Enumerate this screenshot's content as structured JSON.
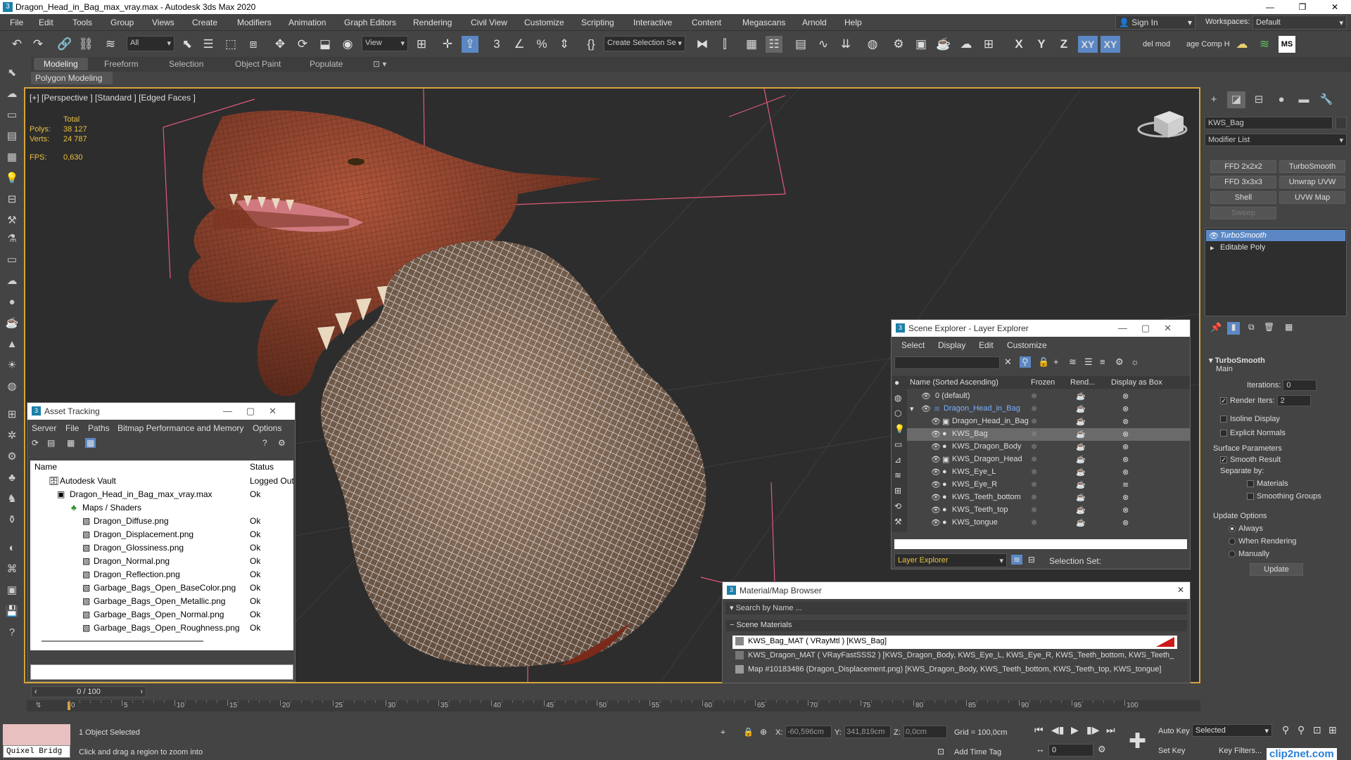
{
  "window": {
    "title": "Dragon_Head_in_Bag_max_vray.max - Autodesk 3ds Max 2020",
    "controls": [
      "—",
      "❐",
      "✕"
    ]
  },
  "menubar": {
    "items": [
      "File",
      "Edit",
      "Tools",
      "Group",
      "Views",
      "Create",
      "Modifiers",
      "Animation",
      "Graph Editors",
      "Rendering",
      "Civil View",
      "Customize",
      "Scripting",
      "Interactive",
      "Content",
      "Megascans",
      "Arnold",
      "Help"
    ],
    "sign_in": "Sign In",
    "workspaces_label": "Workspaces:",
    "workspace_value": "Default"
  },
  "toolbar": {
    "filter_value": "All",
    "ref_coord": "View",
    "create_selection_set": "Create Selection Se",
    "axis_x": "X",
    "axis_y": "Y",
    "axis_z": "Z",
    "axis_xy": "XY",
    "axis_xy2": "XY",
    "del_mod": "del mod",
    "comp_help": "age Comp Hel",
    "ms": "MS"
  },
  "ribbon": {
    "tabs": [
      "Modeling",
      "Freeform",
      "Selection",
      "Object Paint",
      "Populate"
    ],
    "active_panel": "Polygon Modeling"
  },
  "viewport": {
    "label": "[+] [Perspective ] [Standard ] [Edged Faces ]",
    "stats": {
      "total_label": "Total",
      "polys_label": "Polys:",
      "polys": "38 127",
      "verts_label": "Verts:",
      "verts": "24 787",
      "fps_label": "FPS:",
      "fps": "0,630"
    }
  },
  "command_panel": {
    "object_name": "KWS_Bag",
    "modifier_list": "Modifier List",
    "buttons": [
      "FFD 2x2x2",
      "TurboSmooth",
      "FFD 3x3x3",
      "Unwrap UVW",
      "Shell",
      "UVW Map",
      "Sweep"
    ],
    "stack": [
      "TurboSmooth",
      "Editable Poly"
    ],
    "turbosmooth": {
      "title": "TurboSmooth",
      "main": "Main",
      "iterations_label": "Iterations:",
      "iterations": "0",
      "render_iters_label": "Render Iters:",
      "render_iters": "2",
      "isoline": "Isoline Display",
      "explicit_normals": "Explicit Normals",
      "surface_params": "Surface Parameters",
      "smooth_result": "Smooth Result",
      "separate_by": "Separate by:",
      "materials": "Materials",
      "smoothing_groups": "Smoothing Groups",
      "update_options": "Update Options",
      "always": "Always",
      "when_rendering": "When Rendering",
      "manually": "Manually",
      "update_btn": "Update"
    }
  },
  "asset_tracking": {
    "title": "Asset Tracking",
    "menu": [
      "Server",
      "File",
      "Paths",
      "Bitmap Performance and Memory",
      "Options"
    ],
    "columns": [
      "Name",
      "Status"
    ],
    "rows": [
      {
        "name": "Autodesk Vault",
        "status": "Logged Out"
      },
      {
        "name": "Dragon_Head_in_Bag_max_vray.max",
        "status": "Ok"
      },
      {
        "name": "Maps / Shaders",
        "status": ""
      },
      {
        "name": "Dragon_Diffuse.png",
        "status": "Ok"
      },
      {
        "name": "Dragon_Displacement.png",
        "status": "Ok"
      },
      {
        "name": "Dragon_Glossiness.png",
        "status": "Ok"
      },
      {
        "name": "Dragon_Normal.png",
        "status": "Ok"
      },
      {
        "name": "Dragon_Reflection.png",
        "status": "Ok"
      },
      {
        "name": "Garbage_Bags_Open_BaseColor.png",
        "status": "Ok"
      },
      {
        "name": "Garbage_Bags_Open_Metallic.png",
        "status": "Ok"
      },
      {
        "name": "Garbage_Bags_Open_Normal.png",
        "status": "Ok"
      },
      {
        "name": "Garbage_Bags_Open_Roughness.png",
        "status": "Ok"
      }
    ]
  },
  "scene_explorer": {
    "title": "Scene Explorer - Layer Explorer",
    "menu": [
      "Select",
      "Display",
      "Edit",
      "Customize"
    ],
    "columns": [
      "Name (Sorted Ascending)",
      "Frozen",
      "Rend...",
      "Display as Box"
    ],
    "rows": [
      "0 (default)",
      "Dragon_Head_in_Bag",
      "Dragon_Head_in_Bag",
      "KWS_Bag",
      "KWS_Dragon_Body",
      "KWS_Dragon_Head",
      "KWS_Eye_L",
      "KWS_Eye_R",
      "KWS_Teeth_bottom",
      "KWS_Teeth_top",
      "KWS_tongue"
    ],
    "footer_dropdown": "Layer Explorer",
    "selection_set_label": "Selection Set:"
  },
  "material_browser": {
    "title": "Material/Map Browser",
    "search_placeholder": "Search by Name ...",
    "section": "Scene Materials",
    "rows": [
      "KWS_Bag_MAT  ( VRayMtl ) [KWS_Bag]",
      "KWS_Dragon_MAT  ( VRayFastSSS2 ) [KWS_Dragon_Body, KWS_Eye_L, KWS_Eye_R, KWS_Teeth_bottom, KWS_Teeth_",
      "Map #10183486 (Dragon_Displacement.png) [KWS_Dragon_Body, KWS_Teeth_bottom, KWS_Teeth_top, KWS_tongue]"
    ]
  },
  "timeline": {
    "frame": "0 / 100",
    "ticks": [
      "0",
      "5",
      "10",
      "15",
      "20",
      "25",
      "30",
      "35",
      "40",
      "45",
      "50",
      "55",
      "60",
      "65",
      "70",
      "75",
      "80",
      "85",
      "90",
      "95",
      "100"
    ]
  },
  "status": {
    "selected": "1 Object Selected",
    "hint": "Click and drag a region to zoom into",
    "x_label": "X:",
    "x": "-60,596cm",
    "y_label": "Y:",
    "y": "341,819cm",
    "z_label": "Z:",
    "z": "0,0cm",
    "grid": "Grid = 100,0cm",
    "add_time_tag": "Add Time Tag",
    "auto_key": "Auto Key",
    "set_key": "Set Key",
    "key_mode": "Selected",
    "frame_value": "0",
    "key_filters": "Key Filters...",
    "quixel": "Quixel Bridg",
    "watermark": "clip2net.com"
  }
}
